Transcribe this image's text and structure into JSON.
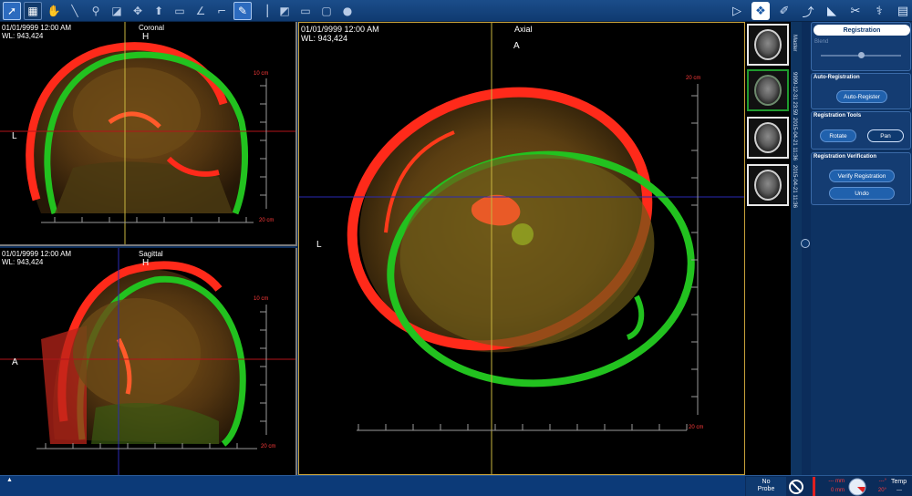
{
  "toolbar": {
    "left_icons": [
      "pointer-icon",
      "select-icon",
      "hand-icon",
      "brush-icon",
      "magnify-icon",
      "window-level-icon",
      "move-icon",
      "up-arrow-icon",
      "ruler-icon",
      "angle-icon",
      "crop-icon",
      "pen-icon",
      "line-icon",
      "eraser-icon",
      "rectangle-icon",
      "ellipse-icon",
      "circle-icon"
    ],
    "right_icons": [
      "play-icon",
      "registration-icon",
      "annotate-icon",
      "trajectory-icon",
      "plan-icon",
      "tools-icon",
      "pointer-probe-icon",
      "report-icon"
    ]
  },
  "viewports": {
    "coronal": {
      "info_line1": "01/01/9999 12:00 AM",
      "info_line2": "WL: 943,424",
      "title": "Coronal",
      "orient_top": "H",
      "orient_left": "L",
      "scale_top": "10 cm",
      "scale_bottom": "20 cm"
    },
    "sagittal": {
      "info_line1": "01/01/9999 12:00 AM",
      "info_line2": "WL: 943,424",
      "title": "Sagittal",
      "orient_top": "H",
      "orient_left": "A",
      "scale_top": "10 cm",
      "scale_bottom": "20 cm"
    },
    "axial": {
      "info_line1": "01/01/9999 12:00 AM",
      "info_line2": "WL: 943,424",
      "title": "Axial",
      "orient_top": "A",
      "orient_left": "L",
      "scale_top": "20 cm",
      "scale_bottom": "20 cm"
    }
  },
  "series": {
    "labels": [
      "Master",
      "9999-12-31 23:59",
      "2015-04-21 11:36",
      "2015-04-21 11:36"
    ]
  },
  "panel": {
    "header": "Registration",
    "blend_label": "Blend",
    "blend_level": 0.5,
    "auto_registration": {
      "title": "Auto-Registration",
      "button": "Auto-Register"
    },
    "registration_tools": {
      "title": "Registration Tools",
      "rotate": "Rotate",
      "pan": "Pan"
    },
    "registration_verification": {
      "title": "Registration Verification",
      "verify": "Verify Registration",
      "undo": "Undo"
    }
  },
  "status": {
    "probe_line1": "No",
    "probe_line2": "Probe",
    "mm_top": "--- mm",
    "mm_bottom": "0 mm",
    "deg_top": "---°",
    "deg_bottom": "20°",
    "temp_label": "Temp",
    "temp_value": "---"
  },
  "colors": {
    "fixed": "#ff2a1a",
    "moving": "#22c21f",
    "frame": "#c9a23a"
  }
}
